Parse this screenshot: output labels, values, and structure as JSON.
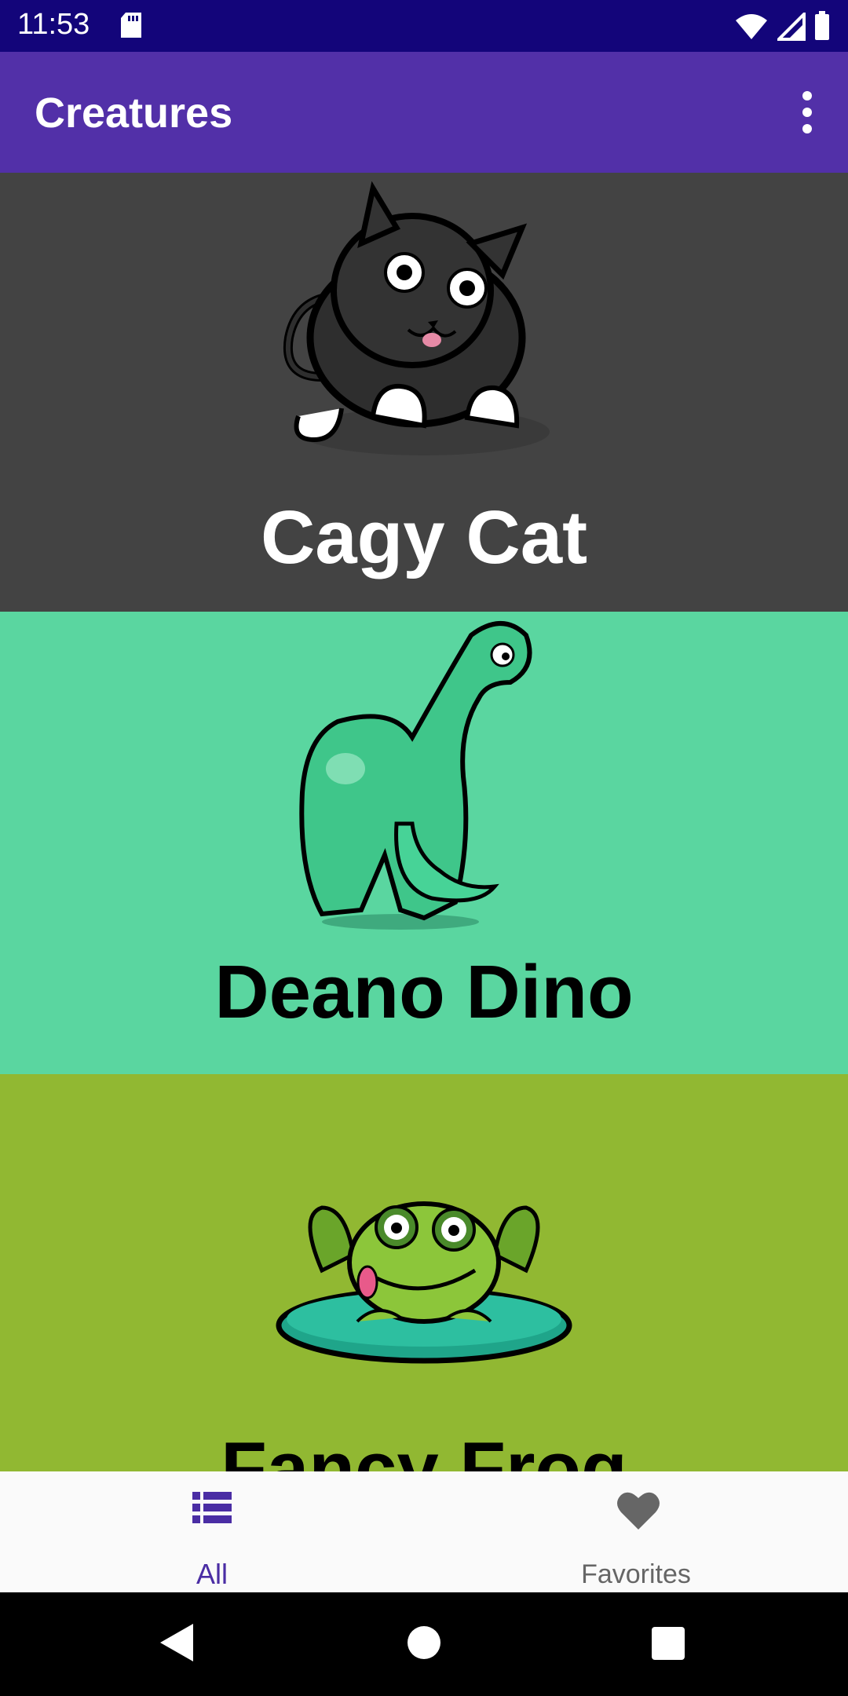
{
  "status_bar": {
    "time": "11:53",
    "background": "#13057a",
    "icons": [
      "sd-card-icon",
      "wifi-icon",
      "signal-icon",
      "battery-icon"
    ]
  },
  "app_bar": {
    "title": "Creatures",
    "background": "#5230a8",
    "menu_icon": "more-vert-icon"
  },
  "creatures": [
    {
      "name": "Cagy Cat",
      "background": "#434343",
      "name_color": "#ffffff",
      "image": "cat-image"
    },
    {
      "name": "Deano Dino",
      "background": "#5ad6a0",
      "name_color": "#000000",
      "image": "dino-image"
    },
    {
      "name": "Fancy Frog",
      "background": "#91b832",
      "name_color": "#000000",
      "image": "frog-image"
    }
  ],
  "bottom_nav": {
    "items": [
      {
        "label": "All",
        "icon": "list-icon",
        "selected": true,
        "color": "#4a2da4"
      },
      {
        "label": "Favorites",
        "icon": "heart-icon",
        "selected": false,
        "color": "#666666"
      }
    ]
  },
  "system_nav": {
    "buttons": [
      "back-icon",
      "home-icon",
      "recents-icon"
    ]
  }
}
